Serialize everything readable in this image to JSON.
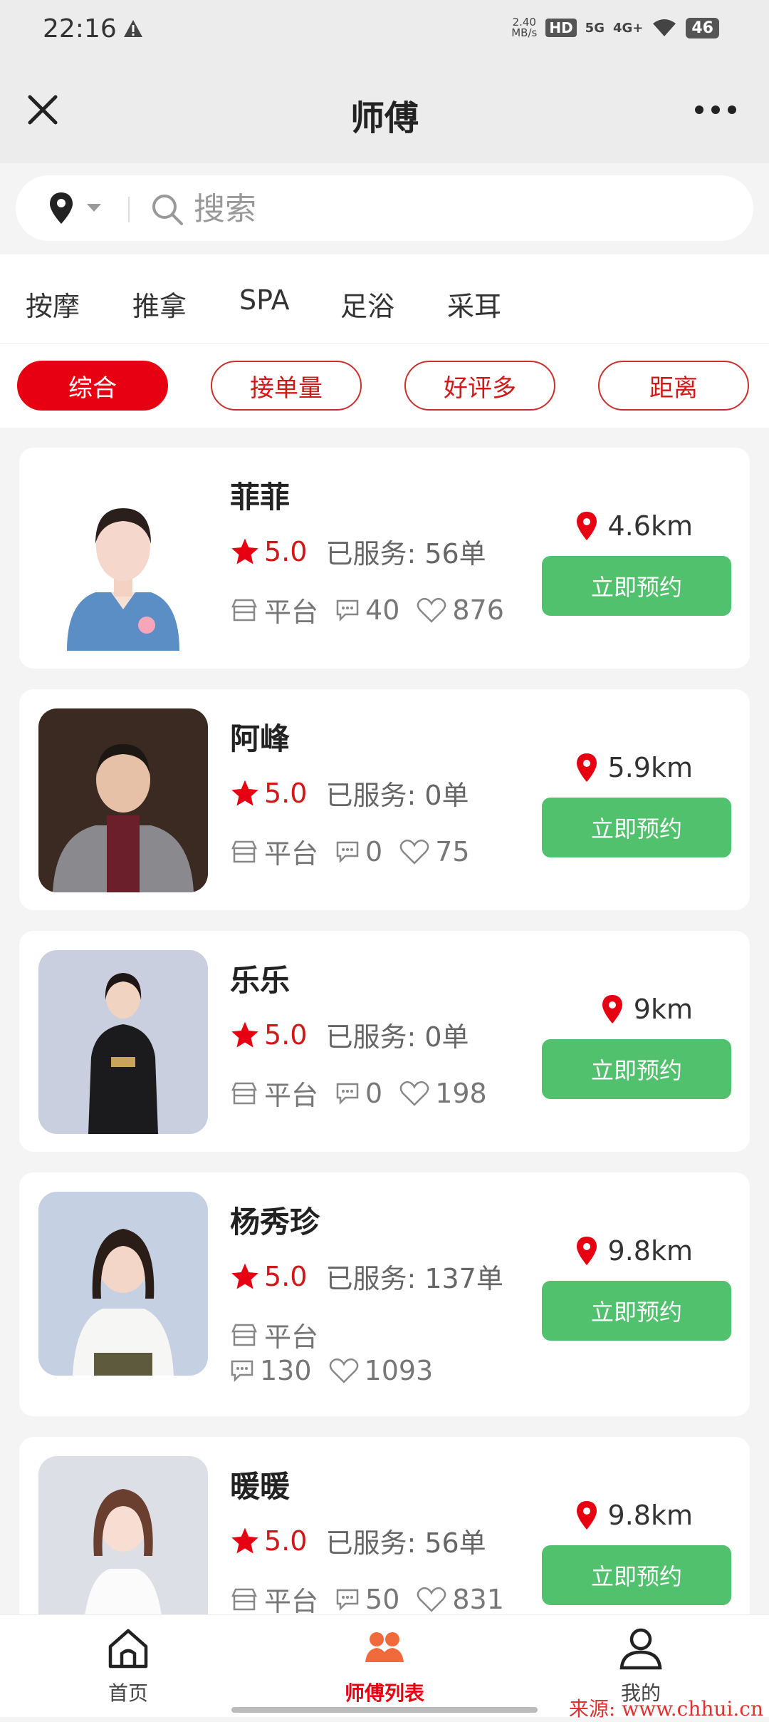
{
  "status_bar": {
    "time": "22:16",
    "net_speed_value": "2.40",
    "net_speed_unit": "MB/s",
    "hd": "HD",
    "sig1": "5G",
    "sig2": "4G+",
    "battery": "46"
  },
  "header": {
    "title": "师傅"
  },
  "search": {
    "placeholder": "搜索"
  },
  "categories": [
    "按摩",
    "推拿",
    "SPA",
    "足浴",
    "采耳"
  ],
  "sort_options": [
    {
      "label": "综合",
      "active": true
    },
    {
      "label": "接单量",
      "active": false
    },
    {
      "label": "好评多",
      "active": false
    },
    {
      "label": "距离",
      "active": false
    }
  ],
  "therapists": [
    {
      "name": "菲菲",
      "rating": "5.0",
      "served": "已服务: 56单",
      "platform": "平台",
      "comments": "40",
      "likes": "876",
      "distance": "4.6km",
      "book_label": "立即预约"
    },
    {
      "name": "阿峰",
      "rating": "5.0",
      "served": "已服务: 0单",
      "platform": "平台",
      "comments": "0",
      "likes": "75",
      "distance": "5.9km",
      "book_label": "立即预约"
    },
    {
      "name": "乐乐",
      "rating": "5.0",
      "served": "已服务: 0单",
      "platform": "平台",
      "comments": "0",
      "likes": "198",
      "distance": "9km",
      "book_label": "立即预约"
    },
    {
      "name": "杨秀珍",
      "rating": "5.0",
      "served": "已服务: 137单",
      "platform": "平台",
      "comments": "130",
      "likes": "1093",
      "distance": "9.8km",
      "book_label": "立即预约"
    },
    {
      "name": "暖暖",
      "rating": "5.0",
      "served": "已服务: 56单",
      "platform": "平台",
      "comments": "50",
      "likes": "831",
      "distance": "9.8km",
      "book_label": "立即预约"
    }
  ],
  "tabbar": {
    "home": "首页",
    "list": "师傅列表",
    "mine": "我的"
  },
  "watermark": "来源: www.chhui.cn",
  "colors": {
    "accent_red": "#e60012",
    "book_green": "#52c16e",
    "pin_red": "#e60012"
  }
}
